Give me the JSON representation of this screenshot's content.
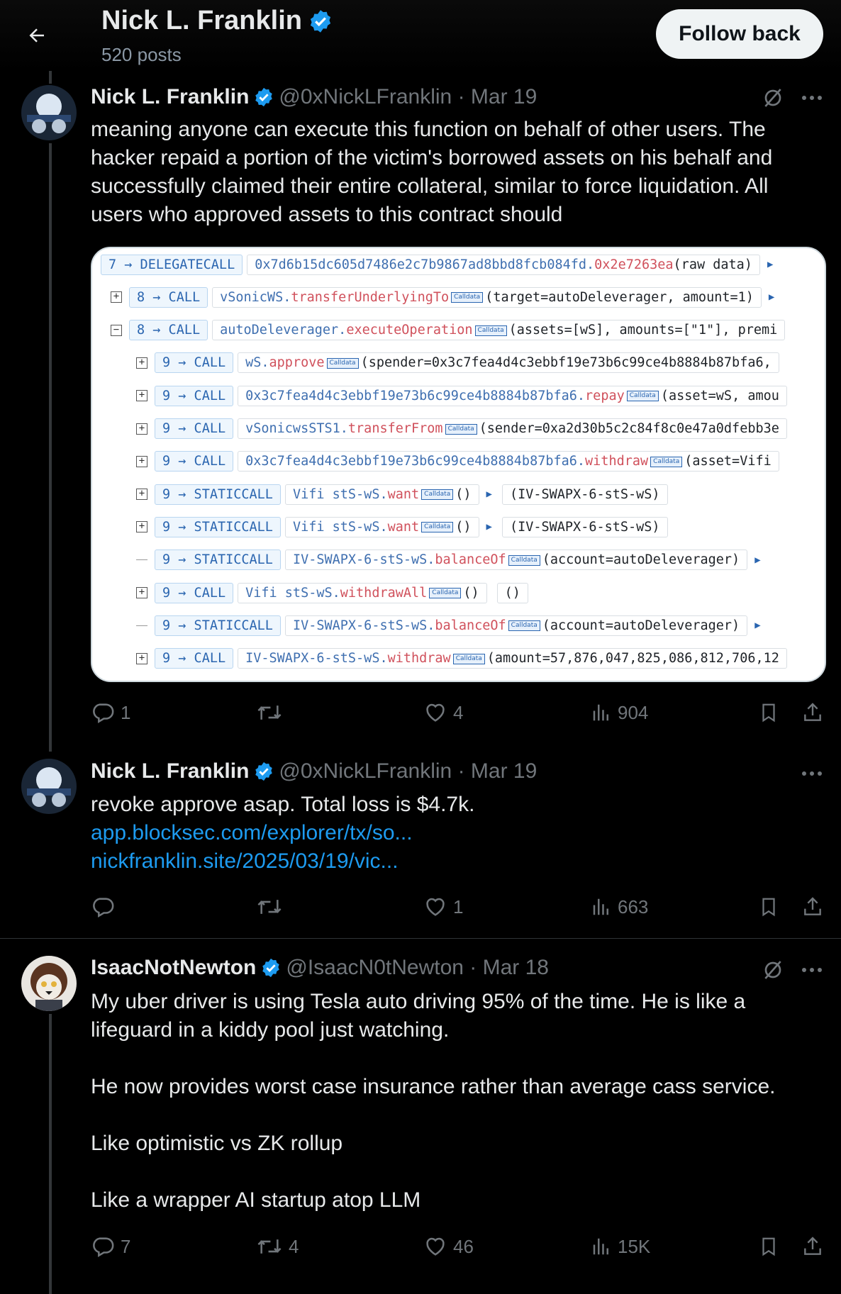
{
  "header": {
    "name": "Nick L. Franklin",
    "posts": "520 posts",
    "follow_label": "Follow back"
  },
  "tweets": [
    {
      "name": "Nick L. Franklin",
      "meta": "@0xNickLFranklin · Mar 19",
      "text": "meaning anyone can execute this function on behalf of other users. The hacker repaid a portion of the victim's borrowed assets on his behalf and successfully claimed their entire collateral, similar to force liquidation. All users who approved assets to this contract should",
      "replies": "1",
      "retweets": "",
      "likes": "4",
      "views": "904"
    },
    {
      "name": "Nick L. Franklin",
      "meta": "@0xNickLFranklin · Mar 19",
      "text": "revoke approve asap. Total loss is $4.7k.",
      "links": [
        "app.blocksec.com/explorer/tx/so...",
        "nickfranklin.site/2025/03/19/vic..."
      ],
      "replies": "",
      "retweets": "",
      "likes": "1",
      "views": "663"
    },
    {
      "name": "IsaacNotNewton",
      "meta": "@IsaacN0tNewton · Mar 18",
      "text": "My uber driver is using Tesla auto driving 95% of the time. He is like a lifeguard in a kiddy pool just watching.\n\nHe now provides worst case insurance rather than average cass service.\n\nLike optimistic vs ZK rollup\n\nLike a wrapper AI startup atop LLM",
      "replies": "7",
      "retweets": "4",
      "likes": "46",
      "views": "15K"
    }
  ],
  "trace": {
    "calldata_label": "Calldata",
    "rows": [
      {
        "call": "7 → DELEGATECALL",
        "target": "0x7d6b15dc605d7486e2c7b9867ad8bbd8fcb084fd.",
        "method": "0x2e7263ea",
        "args": "(raw data)"
      },
      {
        "call": "8 → CALL",
        "target": "vSonicWS.",
        "method": "transferUnderlyingTo",
        "args": "(target=autoDeleverager, amount=1)"
      },
      {
        "call": "8 → CALL",
        "target": "autoDeleverager.",
        "method": "executeOperation",
        "args": "(assets=[wS], amounts=[\"1\"], premi"
      },
      {
        "call": "9 → CALL",
        "target": "wS.",
        "method": "approve",
        "args": "(spender=0x3c7fea4d4c3ebbf19e73b6c99ce4b8884b87bfa6,"
      },
      {
        "call": "9 → CALL",
        "target": "0x3c7fea4d4c3ebbf19e73b6c99ce4b8884b87bfa6.",
        "method": "repay",
        "args": "(asset=wS, amou"
      },
      {
        "call": "9 → CALL",
        "target": "vSonicwsSTS1.",
        "method": "transferFrom",
        "args": "(sender=0xa2d30b5c2c84f8c0e47a0dfebb3e"
      },
      {
        "call": "9 → CALL",
        "target": "0x3c7fea4d4c3ebbf19e73b6c99ce4b8884b87bfa6.",
        "method": "withdraw",
        "args": "(asset=Vifi"
      },
      {
        "call": "9 → STATICCALL",
        "target": "Vifi stS-wS.",
        "method": "want",
        "args": "()",
        "ret": "(IV-SWAPX-6-stS-wS)"
      },
      {
        "call": "9 → STATICCALL",
        "target": "Vifi stS-wS.",
        "method": "want",
        "args": "()",
        "ret": "(IV-SWAPX-6-stS-wS)"
      },
      {
        "call": "9 → STATICCALL",
        "target": "IV-SWAPX-6-stS-wS.",
        "method": "balanceOf",
        "args": "(account=autoDeleverager)"
      },
      {
        "call": "9 → CALL",
        "target": "Vifi stS-wS.",
        "method": "withdrawAll",
        "args": "()",
        "ret": "()"
      },
      {
        "call": "9 → STATICCALL",
        "target": "IV-SWAPX-6-stS-wS.",
        "method": "balanceOf",
        "args": "(account=autoDeleverager)"
      },
      {
        "call": "9 → CALL",
        "target": "IV-SWAPX-6-stS-wS.",
        "method": "withdraw",
        "args": "(amount=57,876,047,825,086,812,706,12"
      }
    ]
  },
  "icons": {
    "back": "arrow-left-icon",
    "verified": "verified-badge-icon",
    "grok": "grok-icon",
    "more": "more-icon",
    "reply": "reply-icon",
    "retweet": "retweet-icon",
    "like": "like-icon",
    "views": "views-icon",
    "bookmark": "bookmark-icon",
    "share": "share-icon"
  },
  "colors": {
    "link": "#1d9bf0",
    "verified": "#1d9bf0",
    "muted": "#71767b"
  }
}
